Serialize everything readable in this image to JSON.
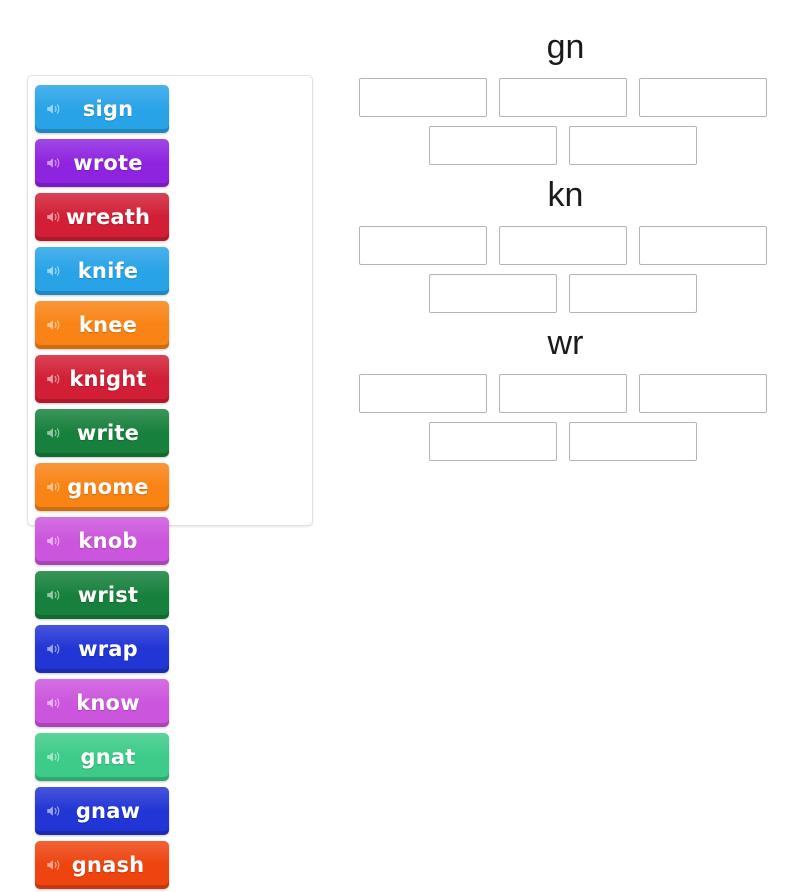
{
  "word_bank": {
    "name": "word-bank",
    "tiles": [
      {
        "word": "sign",
        "color": "#29A3E8",
        "icon": "speaker-icon"
      },
      {
        "word": "wrote",
        "color": "#8E24E0",
        "icon": "speaker-icon"
      },
      {
        "word": "wreath",
        "color": "#D21F35",
        "icon": "speaker-icon"
      },
      {
        "word": "knife",
        "color": "#29A3E8",
        "icon": "speaker-icon"
      },
      {
        "word": "knee",
        "color": "#F98314",
        "icon": "speaker-icon"
      },
      {
        "word": "knight",
        "color": "#D21F35",
        "icon": "speaker-icon"
      },
      {
        "word": "write",
        "color": "#17803C",
        "icon": "speaker-icon"
      },
      {
        "word": "gnome",
        "color": "#F98314",
        "icon": "speaker-icon"
      },
      {
        "word": "knob",
        "color": "#CC55DD",
        "icon": "speaker-icon"
      },
      {
        "word": "wrist",
        "color": "#17803C",
        "icon": "speaker-icon"
      },
      {
        "word": "wrap",
        "color": "#2235D5",
        "icon": "speaker-icon"
      },
      {
        "word": "know",
        "color": "#CC55DD",
        "icon": "speaker-icon"
      },
      {
        "word": "gnat",
        "color": "#3CCB88",
        "icon": "speaker-icon"
      },
      {
        "word": "gnaw",
        "color": "#2235D5",
        "icon": "speaker-icon"
      },
      {
        "word": "gnash",
        "color": "#EE4410",
        "icon": "speaker-icon"
      }
    ]
  },
  "categories": [
    {
      "title": "gn",
      "rows": [
        3,
        2
      ],
      "slots_filled": []
    },
    {
      "title": "kn",
      "rows": [
        3,
        2
      ],
      "slots_filled": []
    },
    {
      "title": "wr",
      "rows": [
        3,
        2
      ],
      "slots_filled": []
    }
  ],
  "colors": {
    "panel_border": "#e3e3e3",
    "slot_border": "#b4b4b4",
    "background": "#ffffff",
    "title_text": "#1a1a1a",
    "tile_text": "#ffffff"
  }
}
